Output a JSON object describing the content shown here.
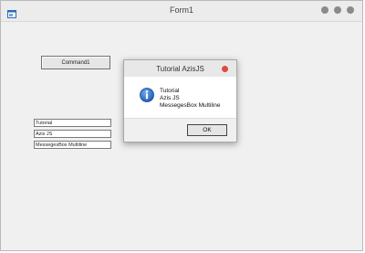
{
  "window": {
    "title": "Form1",
    "icon": "app-window-icon"
  },
  "form": {
    "command_label": "Command1",
    "textboxes": [
      "Tutorial",
      "Azis JS",
      "MessegesBox Multiline"
    ]
  },
  "dialog": {
    "title": "Tutorial AzisJS",
    "icon": "info-icon",
    "message_lines": [
      "Tutorial",
      "Azis JS",
      "MessegesBox Multiline"
    ],
    "ok_label": "OK"
  },
  "colors": {
    "info_blue": "#1f5fb8",
    "close_red": "#e04a3f"
  }
}
